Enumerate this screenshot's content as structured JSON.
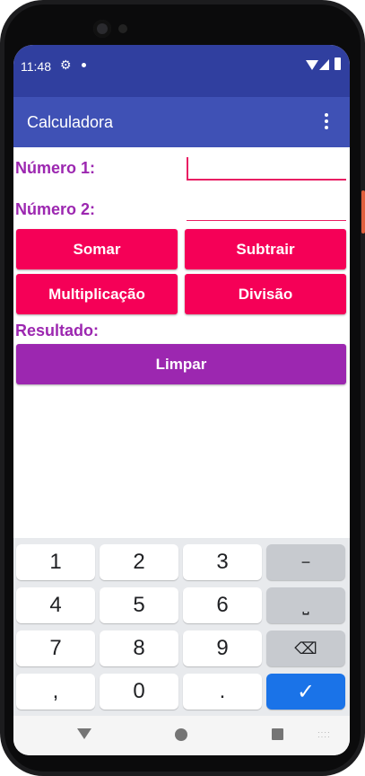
{
  "status": {
    "time": "11:48",
    "settings_icon": "gear-icon",
    "notification_icon": "dot-icon",
    "wifi_icon": "wifi-icon",
    "signal_icon": "signal-icon",
    "battery_icon": "battery-icon"
  },
  "appbar": {
    "title": "Calculadora",
    "menu_icon": "more-vert-icon"
  },
  "form": {
    "label1": "Número 1:",
    "label2": "Número 2:",
    "input1_value": "",
    "input2_value": "",
    "result_label": "Resultado:"
  },
  "buttons": {
    "somar": "Somar",
    "subtrair": "Subtrair",
    "multiplicacao": "Multiplicação",
    "divisao": "Divisão",
    "limpar": "Limpar"
  },
  "keyboard": {
    "row1": [
      "1",
      "2",
      "3",
      "−"
    ],
    "row2": [
      "4",
      "5",
      "6",
      "⎵"
    ],
    "row3": [
      "7",
      "8",
      "9",
      "⌫"
    ],
    "row4": [
      ",",
      "0",
      ".",
      "✓"
    ]
  },
  "colors": {
    "statusbar": "#303f9f",
    "appbar": "#3f51b5",
    "accent": "#f50057",
    "label": "#9c27b0",
    "clear_button": "#9c27b0",
    "enter_key": "#1a73e8"
  }
}
